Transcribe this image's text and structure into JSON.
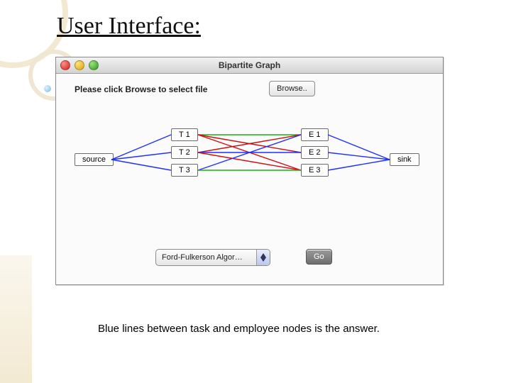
{
  "slide": {
    "title": "User Interface:",
    "caption": "Blue lines between task and employee nodes is the answer."
  },
  "window": {
    "title": "Bipartite Graph",
    "instruction": "Please click Browse to select file",
    "browse_label": "Browse..",
    "algorithm_selected": "Ford-Fulkerson Algor…",
    "go_label": "Go"
  },
  "graph": {
    "source": "source",
    "sink": "sink",
    "tasks": [
      "T 1",
      "T 2",
      "T 3"
    ],
    "employees": [
      "E 1",
      "E 2",
      "E 3"
    ]
  },
  "colors": {
    "blue": "#2030ff",
    "red": "#d01010",
    "green": "#18b018"
  },
  "chart_data": {
    "type": "table",
    "title": "Bipartite Graph edges (task ↔ employee), color-coded",
    "nodes": {
      "source": "source",
      "tasks": [
        "T1",
        "T2",
        "T3"
      ],
      "employees": [
        "E1",
        "E2",
        "E3"
      ],
      "sink": "sink"
    },
    "edges_source_to_tasks": [
      {
        "from": "source",
        "to": "T1",
        "color": "blue"
      },
      {
        "from": "source",
        "to": "T2",
        "color": "blue"
      },
      {
        "from": "source",
        "to": "T3",
        "color": "blue"
      }
    ],
    "edges_task_to_employee": [
      {
        "from": "T1",
        "to": "E1",
        "color": "green"
      },
      {
        "from": "T1",
        "to": "E2",
        "color": "red"
      },
      {
        "from": "T1",
        "to": "E3",
        "color": "red"
      },
      {
        "from": "T2",
        "to": "E1",
        "color": "red"
      },
      {
        "from": "T2",
        "to": "E2",
        "color": "blue"
      },
      {
        "from": "T2",
        "to": "E3",
        "color": "red"
      },
      {
        "from": "T3",
        "to": "E1",
        "color": "blue"
      },
      {
        "from": "T3",
        "to": "E3",
        "color": "green"
      }
    ],
    "edges_employee_to_sink": [
      {
        "from": "E1",
        "to": "sink",
        "color": "blue"
      },
      {
        "from": "E2",
        "to": "sink",
        "color": "blue"
      },
      {
        "from": "E3",
        "to": "sink",
        "color": "blue"
      }
    ],
    "note": "Blue task↔employee edges indicate the computed matching."
  }
}
